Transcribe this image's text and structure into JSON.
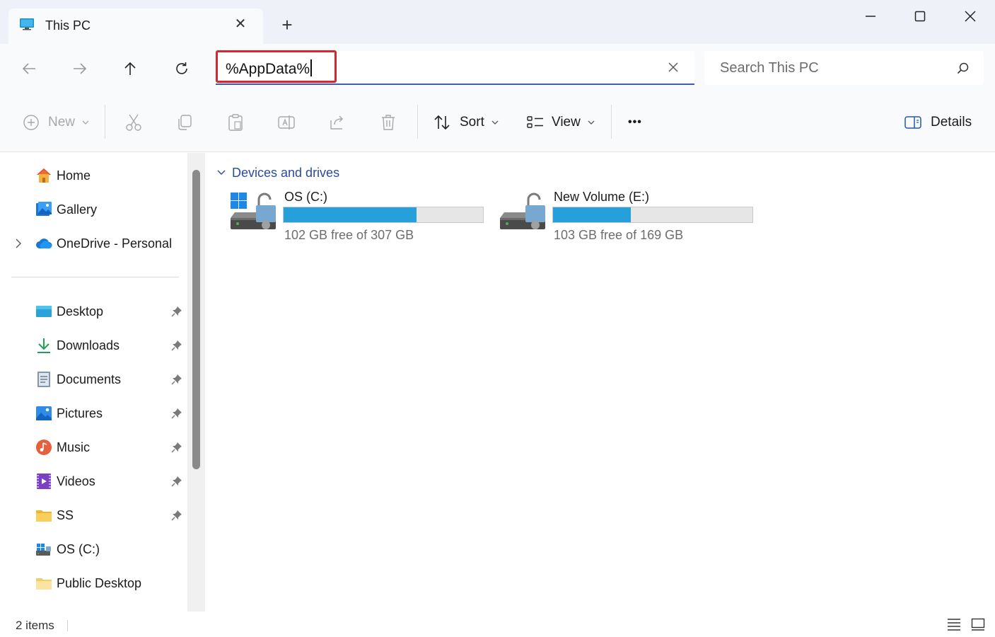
{
  "tab": {
    "title": "This PC",
    "close_glyph": "✕",
    "new_glyph": "+",
    "icon": "monitor-icon"
  },
  "address": {
    "value": "%AppData%"
  },
  "search": {
    "placeholder": "Search This PC"
  },
  "commands": {
    "new_label": "New",
    "sort_label": "Sort",
    "view_label": "View",
    "more_label": "•••",
    "details_label": "Details"
  },
  "sidebar": {
    "top_items": [
      {
        "label": "Home",
        "icon": "home-icon"
      },
      {
        "label": "Gallery",
        "icon": "gallery-icon"
      },
      {
        "label": "OneDrive - Personal",
        "icon": "onedrive-cloud-icon"
      }
    ],
    "pinned_items": [
      {
        "label": "Desktop",
        "icon": "desktop-folder-icon"
      },
      {
        "label": "Downloads",
        "icon": "downloads-icon"
      },
      {
        "label": "Documents",
        "icon": "documents-icon"
      },
      {
        "label": "Pictures",
        "icon": "pictures-icon"
      },
      {
        "label": "Music",
        "icon": "music-icon"
      },
      {
        "label": "Videos",
        "icon": "videos-icon"
      },
      {
        "label": "SS",
        "icon": "folder-icon"
      },
      {
        "label": "OS (C:)",
        "icon": "drive-icon"
      },
      {
        "label": "Public Desktop",
        "icon": "folder-icon"
      }
    ]
  },
  "content": {
    "group_label": "Devices and drives",
    "drives": [
      {
        "name": "OS (C:)",
        "free_text": "102 GB free of 307 GB",
        "used_fraction": 0.668,
        "icon": "windows-drive-locked-icon"
      },
      {
        "name": "New Volume (E:)",
        "free_text": "103 GB free of 169 GB",
        "used_fraction": 0.391,
        "icon": "drive-locked-icon"
      }
    ]
  },
  "status": {
    "items_text": "2 items"
  },
  "colors": {
    "accent": "#26a0da",
    "highlight_border": "#d9252b",
    "link_blue": "#2a4a9b"
  }
}
